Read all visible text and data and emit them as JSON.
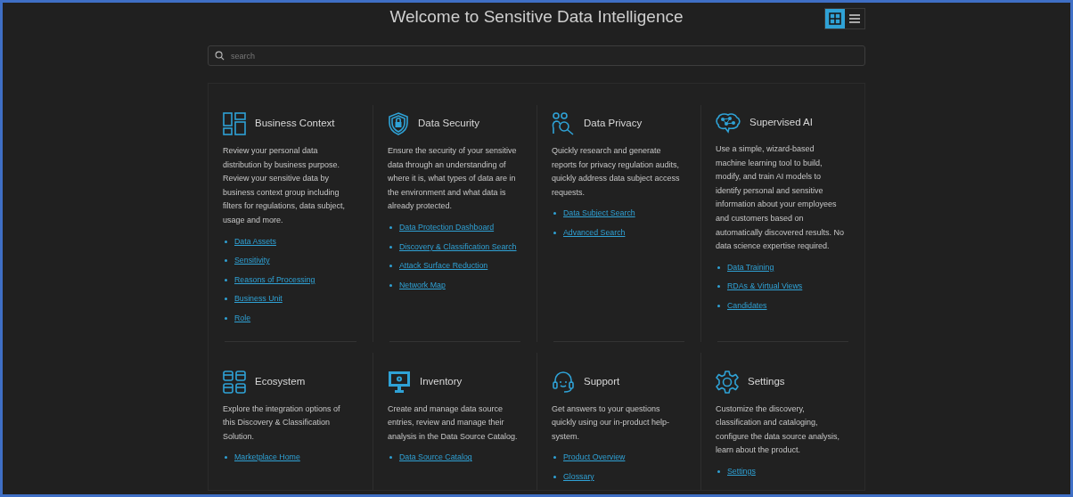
{
  "title": "Welcome to Sensitive Data Intelligence",
  "view_toggle": [
    {
      "kind": "grid",
      "selected": true
    },
    {
      "kind": "list",
      "selected": false
    }
  ],
  "search": {
    "placeholder": "search"
  },
  "sections": [
    {
      "title": "Business Context",
      "description": "Review your personal data distribution by business purpose. Review your sensitive data by business context group including filters for regulations, data subject, usage and more.",
      "links": [
        "Data Assets",
        "Sensitivity",
        "Reasons of Processing",
        "Business Unit",
        "Role"
      ]
    },
    {
      "title": "Data Security",
      "description": "Ensure the security of your sensitive data through an understanding of where it is, what types of data are in the environment and what data is already protected.",
      "links": [
        "Data Protection Dashboard",
        "Discovery & Classification Search",
        "Attack Surface Reduction",
        "Network Map"
      ]
    },
    {
      "title": "Data Privacy",
      "description": "Quickly research and generate reports for privacy regulation audits, quickly address data subject access requests.",
      "links": [
        "Data Subject Search",
        "Advanced Search"
      ]
    },
    {
      "title": "Supervised AI",
      "description": "Use a simple, wizard-based machine learning tool to build, modify, and train AI models to identify personal and sensitive information about your employees and customers based on automatically discovered results. No data science expertise required.",
      "links": [
        "Data Training",
        "RDAs & Virtual Views",
        "Candidates"
      ]
    },
    {
      "title": "Ecosystem",
      "description": "Explore the integration options of this Discovery & Classification Solution.",
      "links": [
        "Marketplace Home"
      ]
    },
    {
      "title": "Inventory",
      "description": "Create and manage data source entries, review and manage their analysis in the Data Source Catalog.",
      "links": [
        "Data Source Catalog"
      ]
    },
    {
      "title": "Support",
      "description": "Get answers to your questions quickly using our in-product help-system.",
      "links": [
        "Product Overview",
        "Glossary"
      ]
    },
    {
      "title": "Settings",
      "description": "Customize the discovery, classification and cataloging, configure the data source analysis, learn about the product.",
      "links": [
        "Settings"
      ]
    }
  ]
}
